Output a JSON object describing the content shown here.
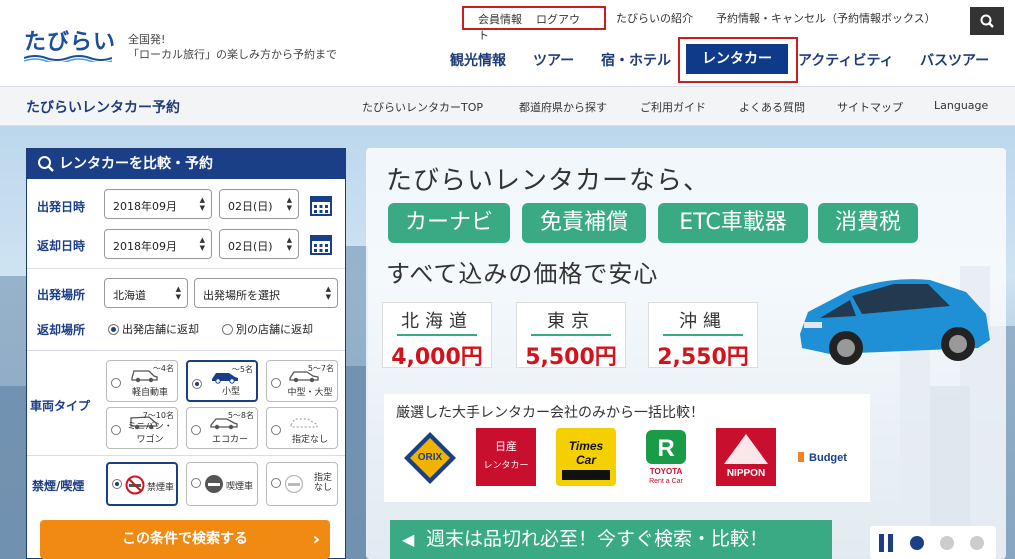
{
  "header": {
    "logo_text": "たびらい",
    "tagline_line1": "全国発!",
    "tagline_line2": "「ローカル旅行」の楽しみ方から予約まで",
    "member_links": [
      "会員情報",
      "ログアウト"
    ],
    "about_link": "たびらいの紹介",
    "reserve_link": "予約情報・キャンセル（予約情報ボックス）",
    "main_nav": [
      "観光情報",
      "ツアー",
      "宿・ホテル",
      "レンタカー",
      "アクティビティ",
      "バスツアー"
    ],
    "active_nav": "レンタカー"
  },
  "subheader": {
    "title": "たびらいレンタカー予約",
    "links": [
      "たびらいレンタカーTOP",
      "都道府県から探す",
      "ご利用ガイド",
      "よくある質問",
      "サイトマップ",
      "Language"
    ]
  },
  "search": {
    "title": "レンタカーを比較・予約",
    "depart_label": "出発日時",
    "return_label": "返却日時",
    "depart_month": "2018年09月",
    "depart_day": "02日(日)",
    "return_month": "2018年09月",
    "return_day": "02日(日)",
    "place_label": "出発場所",
    "place_pref": "北海道",
    "place_select": "出発場所を選択",
    "return_place_label": "返却場所",
    "return_options": [
      "出発店舗に返却",
      "別の店舗に返却"
    ],
    "vehicle_label": "車両タイプ",
    "vehicles": [
      {
        "name": "軽自動車",
        "cap": "～4名"
      },
      {
        "name": "小型",
        "cap": "～5名"
      },
      {
        "name": "中型・大型",
        "cap": "5～7名"
      },
      {
        "name": "ミニバン・ワゴン",
        "cap": "7～10名"
      },
      {
        "name": "エコカー",
        "cap": "5～8名"
      },
      {
        "name": "指定なし",
        "cap": ""
      }
    ],
    "smoke_label": "禁煙/喫煙",
    "smoke_options": [
      "禁煙車",
      "喫煙車",
      "指定なし"
    ],
    "submit": "この条件で検索する"
  },
  "promo": {
    "headline": "たびらいレンタカーなら、",
    "pills": [
      "カーナビ",
      "免責補償",
      "ETC車載器",
      "消費税"
    ],
    "subline": "すべて込みの価格で安心",
    "prices": [
      {
        "region": "北海道",
        "price": "4,000円"
      },
      {
        "region": "東京",
        "price": "5,500円"
      },
      {
        "region": "沖縄",
        "price": "2,550円"
      }
    ],
    "compare_text": "厳選した大手レンタカー会社のみから一括比較！",
    "brands": [
      "ORIX Rent-A-Car",
      "日産レンタカー",
      "Times Car RENTAL",
      "TOYOTA Rent a Car",
      "NIPPON Rent-A-Car",
      "Budget"
    ],
    "weekend": "週末は品切れ必至！今すぐ検索・比較！"
  }
}
